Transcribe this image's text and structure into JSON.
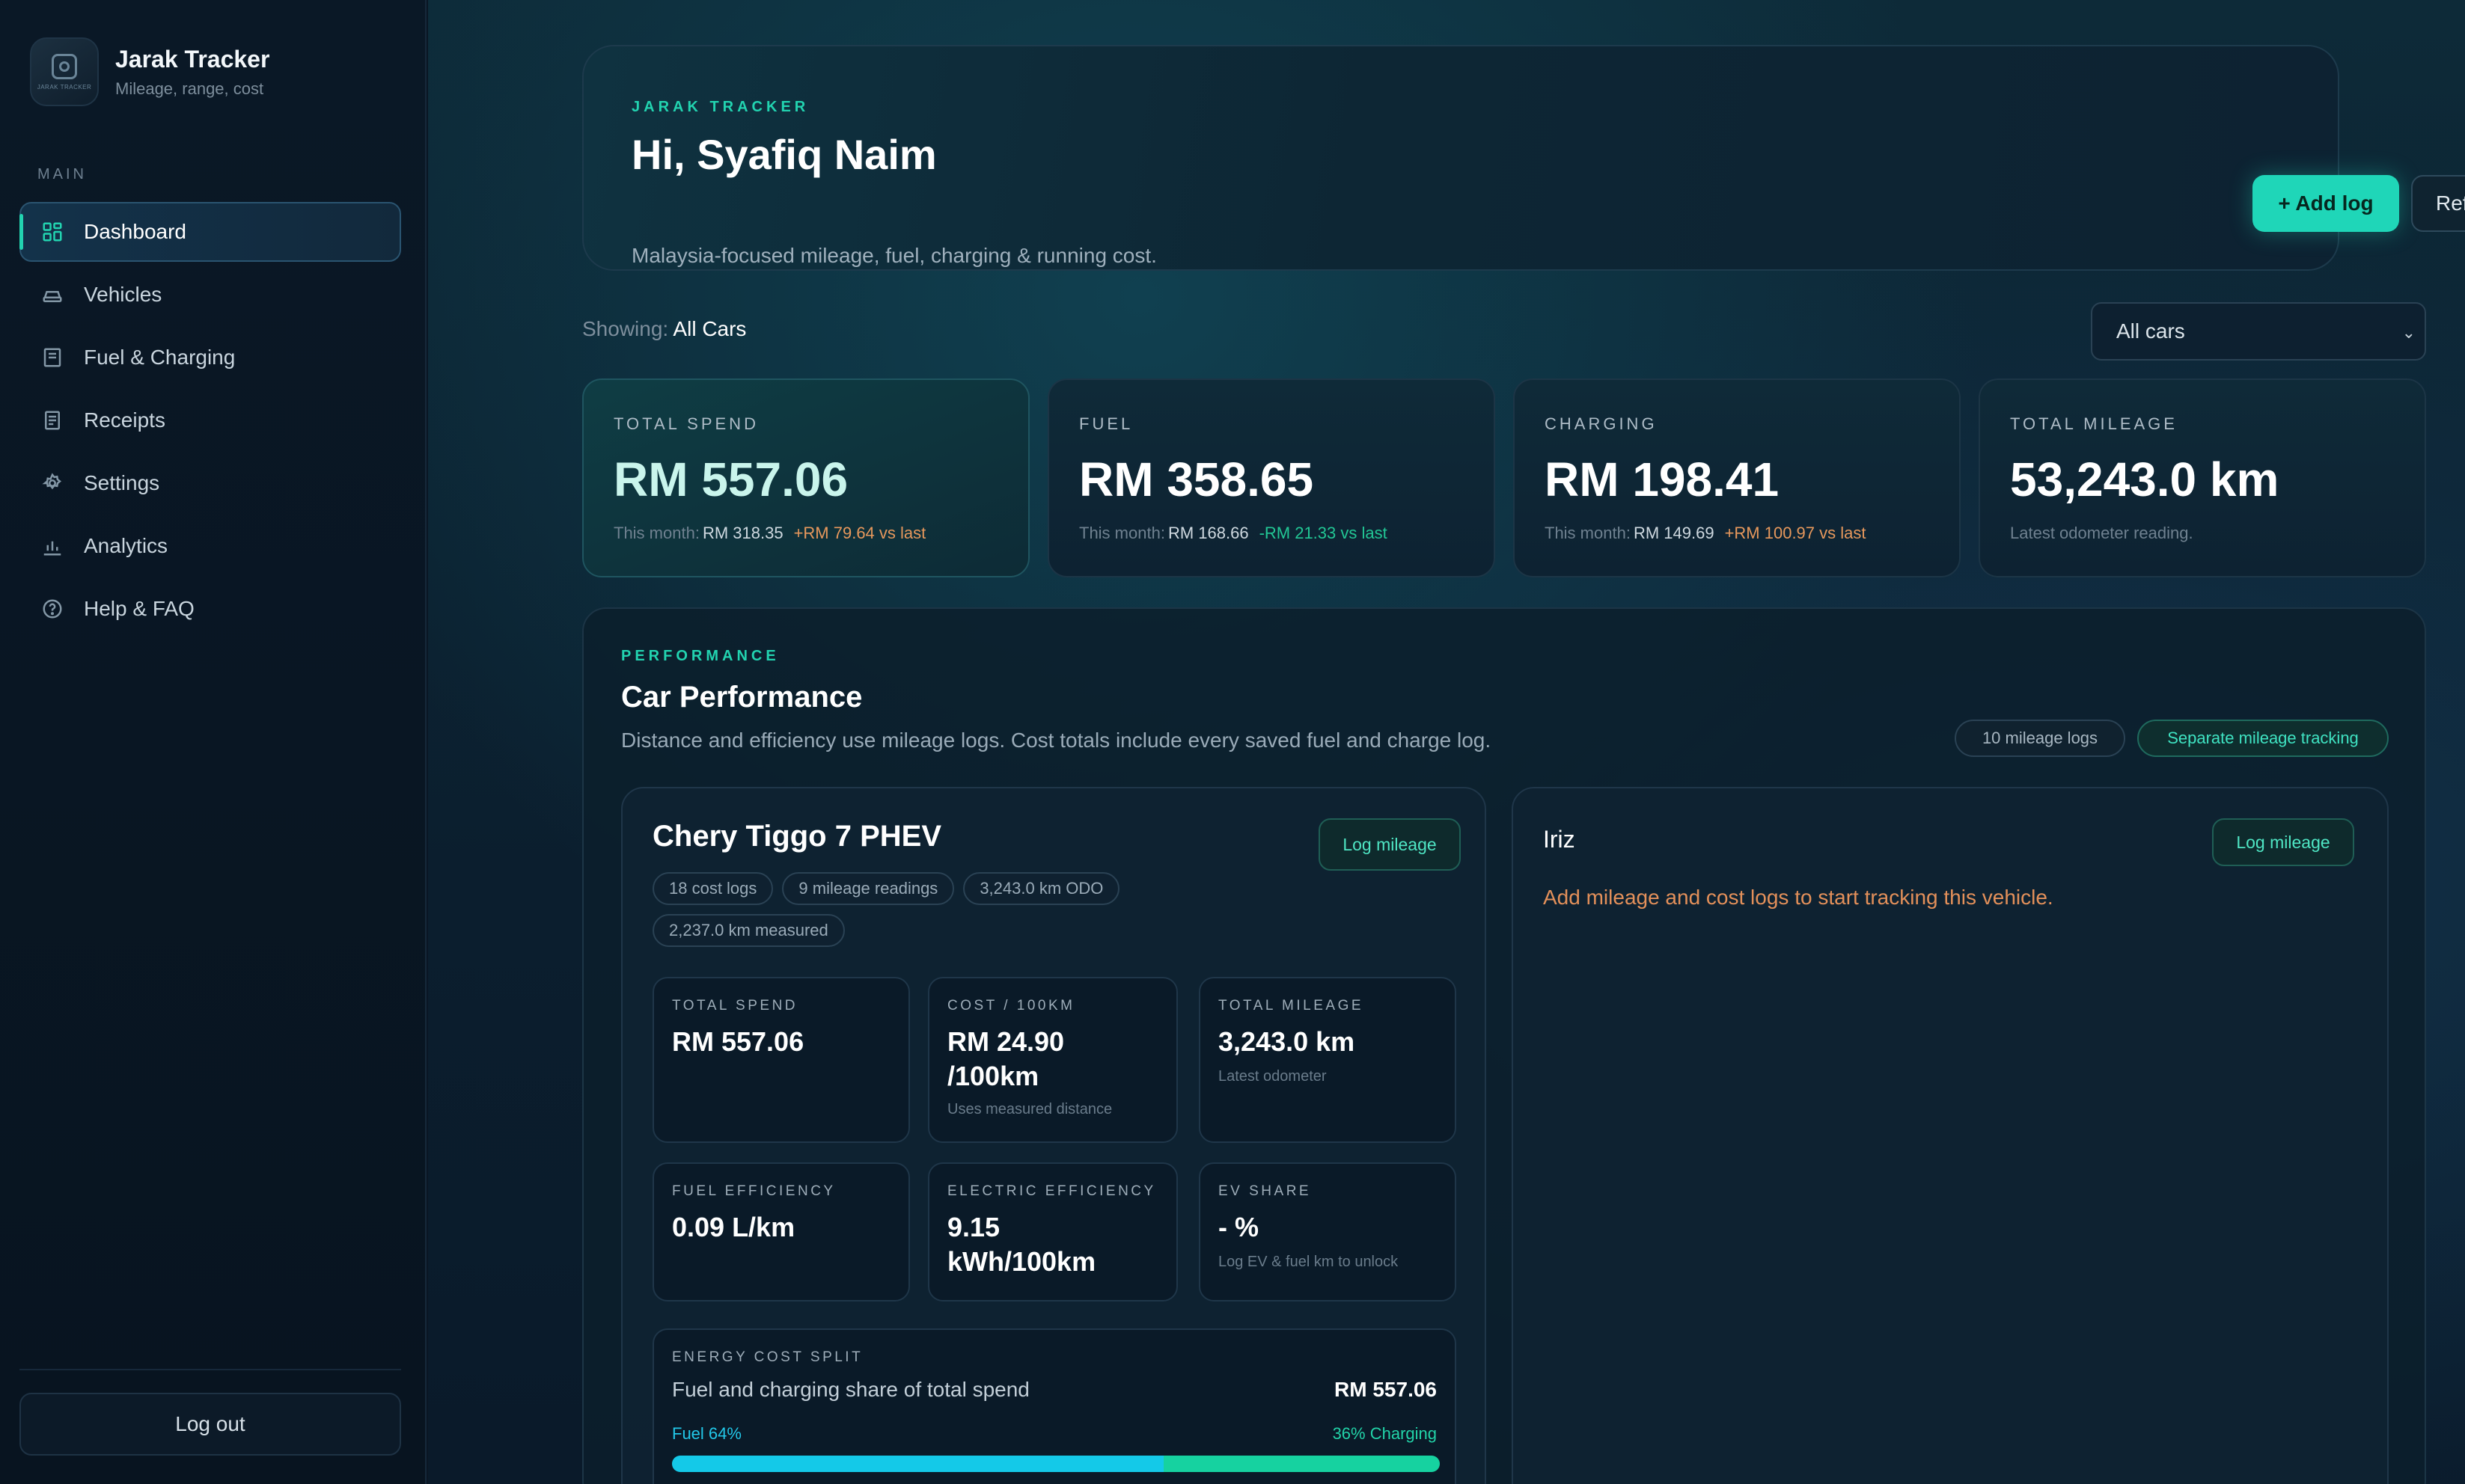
{
  "app": {
    "title": "Jarak Tracker",
    "subtitle": "Mileage, range, cost",
    "logo_text": "JARAK TRACKER"
  },
  "sidebar": {
    "section_label": "MAIN",
    "items": [
      {
        "label": "Dashboard",
        "icon": "dashboard-icon",
        "active": true
      },
      {
        "label": "Vehicles",
        "icon": "car-icon"
      },
      {
        "label": "Fuel & Charging",
        "icon": "fuel-icon"
      },
      {
        "label": "Receipts",
        "icon": "receipt-icon"
      },
      {
        "label": "Settings",
        "icon": "gear-icon"
      },
      {
        "label": "Analytics",
        "icon": "bar-chart-icon"
      },
      {
        "label": "Help & FAQ",
        "icon": "help-icon"
      }
    ],
    "logout_label": "Log out"
  },
  "hero": {
    "eyebrow": "JARAK TRACKER",
    "title": "Hi, Syafiq Naim",
    "subtitle": "Malaysia-focused mileage, fuel, charging & running cost.",
    "add_log_label": "+ Add log",
    "refresh_label": "Refresh"
  },
  "filter": {
    "showing_label": "Showing:",
    "showing_value": "All Cars",
    "select_value": "All cars"
  },
  "stats": [
    {
      "label": "TOTAL SPEND",
      "value": "RM 557.06",
      "sub_label": "This month:",
      "sub_value": "RM 318.35",
      "delta": "+RM 79.64 vs last",
      "delta_dir": "up"
    },
    {
      "label": "FUEL",
      "value": "RM 358.65",
      "sub_label": "This month:",
      "sub_value": "RM 168.66",
      "delta": "-RM 21.33 vs last",
      "delta_dir": "down"
    },
    {
      "label": "CHARGING",
      "value": "RM 198.41",
      "sub_label": "This month:",
      "sub_value": "RM 149.69",
      "delta": "+RM 100.97 vs last",
      "delta_dir": "up"
    },
    {
      "label": "TOTAL MILEAGE",
      "value": "53,243.0 km",
      "sub_label": "Latest odometer reading.",
      "sub_value": "",
      "delta": "",
      "delta_dir": ""
    }
  ],
  "performance": {
    "eyebrow": "PERFORMANCE",
    "title": "Car Performance",
    "description": "Distance and efficiency use mileage logs. Cost totals include every saved fuel and charge log.",
    "mileage_logs_pill": "10 mileage logs",
    "tracking_pill": "Separate mileage tracking",
    "cars": [
      {
        "name": "Chery Tiggo 7 PHEV",
        "log_button": "Log mileage",
        "chips": [
          "18 cost logs",
          "9 mileage readings",
          "3,243.0 km ODO",
          "2,237.0 km measured"
        ],
        "metrics": [
          {
            "label": "TOTAL SPEND",
            "value": "RM 557.06",
            "sub": ""
          },
          {
            "label": "COST / 100KM",
            "value": "RM 24.90 /100km",
            "sub": "Uses measured distance"
          },
          {
            "label": "TOTAL MILEAGE",
            "value": "3,243.0 km",
            "sub": "Latest odometer"
          },
          {
            "label": "FUEL EFFICIENCY",
            "value": "0.09 L/km",
            "sub": ""
          },
          {
            "label": "ELECTRIC EFFICIENCY",
            "value": "9.15 kWh/100km",
            "sub": ""
          },
          {
            "label": "EV SHARE",
            "value": "- %",
            "sub": "Log EV & fuel km to unlock"
          }
        ],
        "split": {
          "label": "ENERGY COST SPLIT",
          "description": "Fuel and charging share of total spend",
          "total": "RM 557.06",
          "fuel_label": "Fuel 64%",
          "charging_label": "36% Charging",
          "fuel_fraction": 0.64
        }
      },
      {
        "name": "Iriz",
        "log_button": "Log mileage",
        "empty_message": "Add mileage and cost logs to start tracking this vehicle."
      }
    ]
  },
  "colors": {
    "accent": "#1fd6b8",
    "fuel": "#14c9e8",
    "charging": "#16d2a0",
    "warning": "#e3905a"
  }
}
